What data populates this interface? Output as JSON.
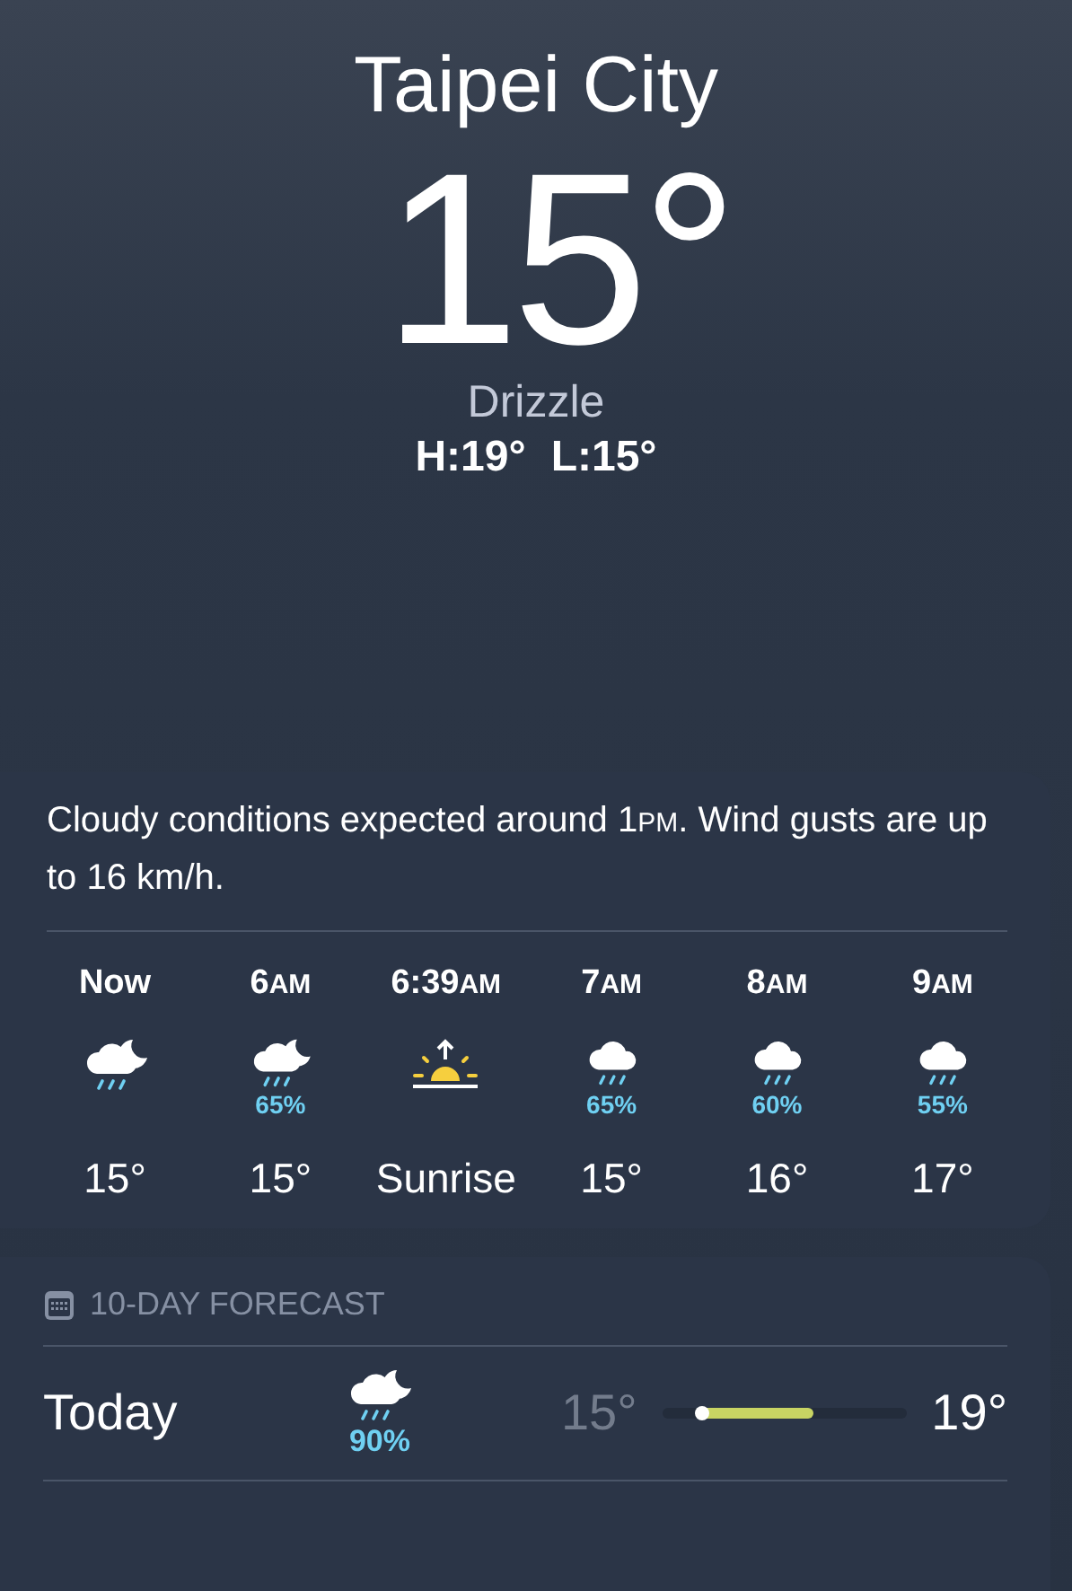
{
  "location": {
    "city": "Taipei City",
    "temperature": "15°",
    "condition": "Drizzle",
    "high": "H:19°",
    "low": "L:15°"
  },
  "hourly": {
    "summary": [
      "Cloudy conditions expected around 1",
      "PM",
      ". Wind gusts are up to 16 km/h."
    ],
    "hours": [
      {
        "time": "Now",
        "kind": "moon-rain",
        "value": "15°"
      },
      {
        "time": "6",
        "suffix": "AM",
        "kind": "moon-rain",
        "chance": "65%",
        "value": "15°"
      },
      {
        "time": "6:39",
        "suffix": "AM",
        "kind": "sunrise",
        "value": "Sunrise"
      },
      {
        "time": "7",
        "suffix": "AM",
        "kind": "rain",
        "chance": "65%",
        "value": "15°"
      },
      {
        "time": "8",
        "suffix": "AM",
        "kind": "rain",
        "chance": "60%",
        "value": "16°"
      },
      {
        "time": "9",
        "suffix": "AM",
        "kind": "rain",
        "chance": "55%",
        "value": "17°"
      }
    ]
  },
  "forecast": {
    "title": "10-DAY FORECAST",
    "days": [
      {
        "day": "Today",
        "kind": "moon-rain",
        "chance": "90%",
        "low": "15°",
        "high": "19°"
      }
    ]
  }
}
